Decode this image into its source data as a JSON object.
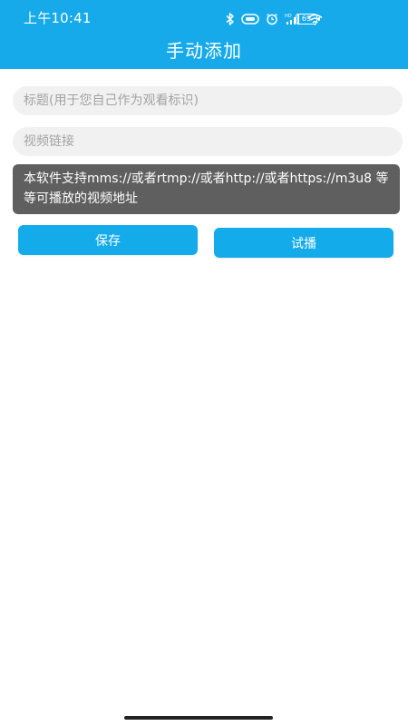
{
  "status_bar": {
    "time": "上午10:41",
    "battery": "69",
    "icons": [
      "bluetooth-icon",
      "nfc-icon",
      "alarm-icon",
      "signal-hd-icon",
      "wifi-icon",
      "battery-icon"
    ]
  },
  "header": {
    "title": "手动添加",
    "color": "#16aaea"
  },
  "form": {
    "title_placeholder": "标题(用于您自己作为观看标识)",
    "link_placeholder": "视频链接"
  },
  "hint": {
    "text": "本软件支持mms://或者rtmp://或者http://或者https://m3u8 等等可播放的视频地址"
  },
  "buttons": {
    "save_label": "保存",
    "try_label": "试播",
    "color": "#14abea"
  }
}
